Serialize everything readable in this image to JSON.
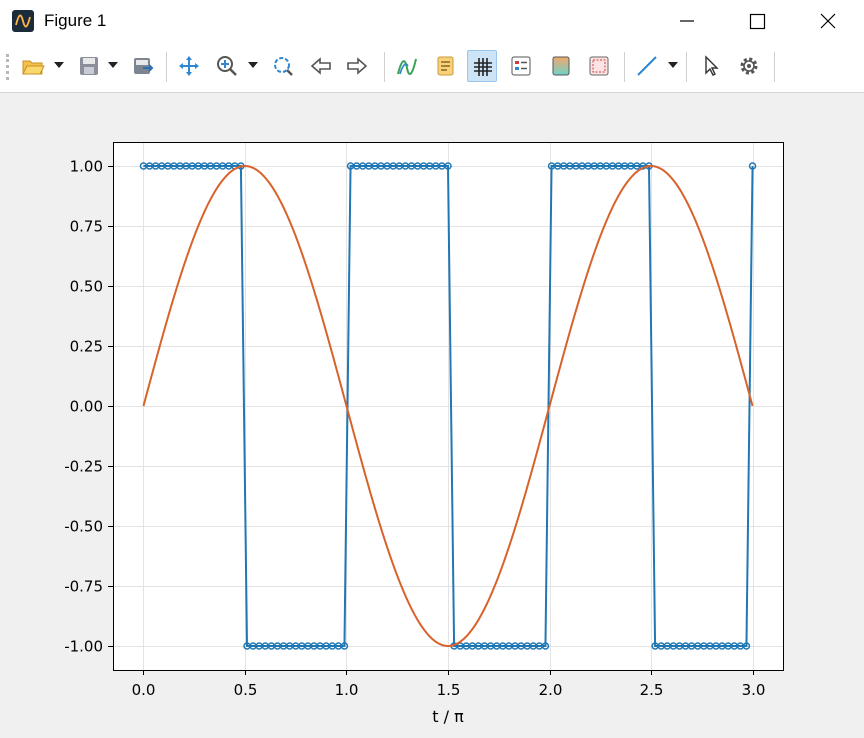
{
  "window": {
    "title": "Figure 1"
  },
  "toolbar": {
    "buttons": [
      {
        "name": "open",
        "icon": "folder-open-icon"
      },
      {
        "name": "save",
        "icon": "save-icon"
      },
      {
        "name": "export",
        "icon": "export-icon"
      },
      {
        "name": "pan",
        "icon": "move-icon"
      },
      {
        "name": "zoom",
        "icon": "zoom-in-icon"
      },
      {
        "name": "zoom-fit",
        "icon": "zoom-fit-icon"
      },
      {
        "name": "back",
        "icon": "arrow-left-icon"
      },
      {
        "name": "forward",
        "icon": "arrow-right-icon"
      },
      {
        "name": "curves",
        "icon": "curves-icon"
      },
      {
        "name": "labels",
        "icon": "labels-icon"
      },
      {
        "name": "grid",
        "icon": "grid-icon",
        "active": true
      },
      {
        "name": "legend",
        "icon": "legend-icon"
      },
      {
        "name": "colorbar",
        "icon": "colorbar-icon"
      },
      {
        "name": "frame",
        "icon": "frame-icon"
      },
      {
        "name": "line",
        "icon": "line-icon"
      },
      {
        "name": "select",
        "icon": "cursor-icon"
      },
      {
        "name": "settings",
        "icon": "gear-icon"
      }
    ]
  },
  "chart_data": {
    "type": "line",
    "title": "",
    "xlabel": "t / π",
    "ylabel": "",
    "xlim": [
      -0.15,
      3.15
    ],
    "ylim": [
      -1.1,
      1.1
    ],
    "xticks": [
      0.0,
      0.5,
      1.0,
      1.5,
      2.0,
      2.5,
      3.0
    ],
    "xtick_labels": [
      "0.0",
      "0.5",
      "1.0",
      "1.5",
      "2.0",
      "2.5",
      "3.0"
    ],
    "yticks": [
      1.0,
      0.75,
      0.5,
      0.25,
      0.0,
      -0.25,
      -0.5,
      -0.75,
      -1.0
    ],
    "ytick_labels": [
      "1.00",
      "0.75",
      "0.50",
      "0.25",
      "0.00",
      "-0.25",
      "-0.50",
      "-0.75",
      "-1.00"
    ],
    "grid": true,
    "series": [
      {
        "color": "#1f77b4",
        "marker": "circle",
        "x": [
          0.0,
          0.03,
          0.06,
          0.09,
          0.12,
          0.15,
          0.18,
          0.21,
          0.24,
          0.27,
          0.3,
          0.33,
          0.36,
          0.39,
          0.42,
          0.45,
          0.48,
          0.51,
          0.54,
          0.57,
          0.6,
          0.63,
          0.66,
          0.69,
          0.72,
          0.75,
          0.78,
          0.81,
          0.84,
          0.87,
          0.9,
          0.93,
          0.96,
          0.99,
          1.02,
          1.05,
          1.08,
          1.11,
          1.14,
          1.17,
          1.2,
          1.23,
          1.26,
          1.29,
          1.32,
          1.35,
          1.38,
          1.41,
          1.44,
          1.47,
          1.5,
          1.53,
          1.56,
          1.59,
          1.62,
          1.65,
          1.68,
          1.71,
          1.74,
          1.77,
          1.8,
          1.83,
          1.86,
          1.89,
          1.92,
          1.95,
          1.98,
          2.01,
          2.04,
          2.07,
          2.1,
          2.13,
          2.16,
          2.19,
          2.22,
          2.25,
          2.28,
          2.31,
          2.34,
          2.37,
          2.4,
          2.43,
          2.46,
          2.49,
          2.52,
          2.55,
          2.58,
          2.61,
          2.64,
          2.67,
          2.7,
          2.73,
          2.76,
          2.79,
          2.82,
          2.85,
          2.88,
          2.91,
          2.94,
          2.97,
          3.0
        ],
        "y": [
          1,
          1,
          1,
          1,
          1,
          1,
          1,
          1,
          1,
          1,
          1,
          1,
          1,
          1,
          1,
          1,
          1,
          -1,
          -1,
          -1,
          -1,
          -1,
          -1,
          -1,
          -1,
          -1,
          -1,
          -1,
          -1,
          -1,
          -1,
          -1,
          -1,
          -1,
          1,
          1,
          1,
          1,
          1,
          1,
          1,
          1,
          1,
          1,
          1,
          1,
          1,
          1,
          1,
          1,
          1,
          -1,
          -1,
          -1,
          -1,
          -1,
          -1,
          -1,
          -1,
          -1,
          -1,
          -1,
          -1,
          -1,
          -1,
          -1,
          -1,
          1,
          1,
          1,
          1,
          1,
          1,
          1,
          1,
          1,
          1,
          1,
          1,
          1,
          1,
          1,
          1,
          1,
          -1,
          -1,
          -1,
          -1,
          -1,
          -1,
          -1,
          -1,
          -1,
          -1,
          -1,
          -1,
          -1,
          -1,
          -1,
          -1,
          1
        ]
      },
      {
        "color": "#d9622b",
        "marker": "none",
        "function": "sin(π t)",
        "x_range": [
          0,
          3
        ]
      }
    ]
  }
}
